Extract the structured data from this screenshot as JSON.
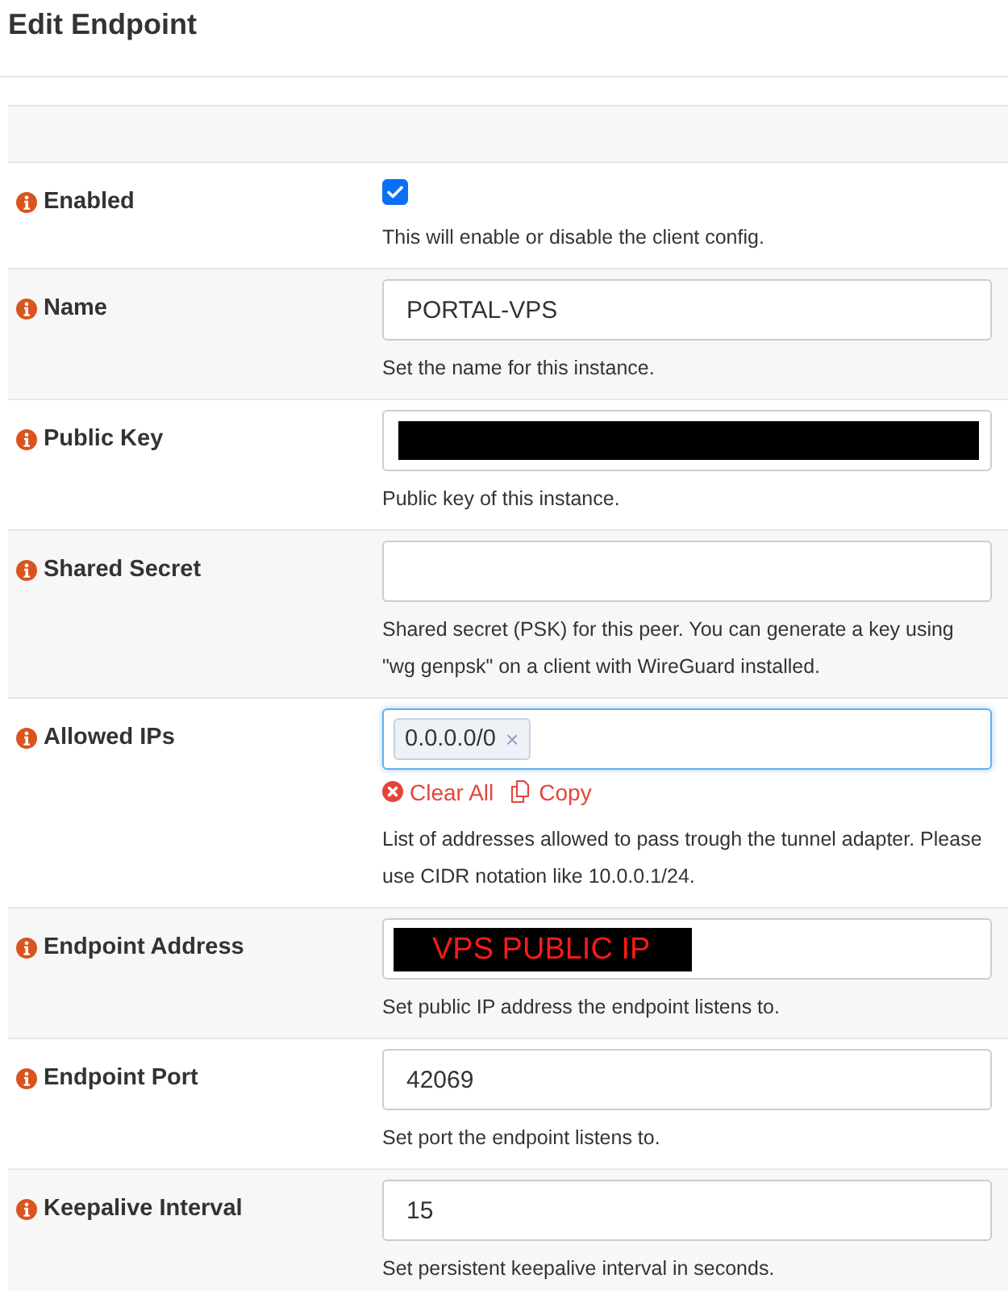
{
  "page": {
    "title": "Edit Endpoint"
  },
  "rows": [
    {
      "label": "Enabled",
      "field": {
        "kind": "checkbox",
        "checked": true
      },
      "help": "This will enable or disable the client config."
    },
    {
      "label": "Name",
      "field": {
        "kind": "text",
        "value": "PORTAL-VPS",
        "redacted": false,
        "focused": false
      },
      "help": "Set the name for this instance."
    },
    {
      "label": "Public Key",
      "field": {
        "kind": "text",
        "redacted": true,
        "focused": false
      },
      "help": "Public key of this instance."
    },
    {
      "label": "Shared Secret",
      "field": {
        "kind": "text",
        "redacted": false,
        "focused": false
      },
      "help": "Shared secret (PSK) for this peer. You can generate a key using \"wg genpsk\" on a client with WireGuard installed."
    },
    {
      "label": "Allowed IPs",
      "field": {
        "kind": "tags",
        "focused": true,
        "tags": [
          {
            "label": "0.0.0.0/0",
            "remove": "×"
          }
        ],
        "actions": [
          {
            "kind": "clear",
            "label": "Clear All"
          },
          {
            "kind": "copy",
            "label": "Copy"
          }
        ]
      },
      "help": "List of addresses allowed to pass trough the tunnel adapter. Please use CIDR notation like 10.0.0.1/24."
    },
    {
      "label": "Endpoint Address",
      "field": {
        "kind": "text",
        "value": "VPS PUBLIC IP",
        "redacted": true,
        "focused": false
      },
      "help": "Set public IP address the endpoint listens to."
    },
    {
      "label": "Endpoint Port",
      "field": {
        "kind": "text",
        "value": "42069",
        "redacted": false,
        "focused": false
      },
      "help": "Set port the endpoint listens to."
    },
    {
      "label": "Keepalive Interval",
      "field": {
        "kind": "text",
        "value": "15",
        "redacted": false,
        "focused": false
      },
      "help": "Set persistent keepalive interval in seconds."
    }
  ]
}
